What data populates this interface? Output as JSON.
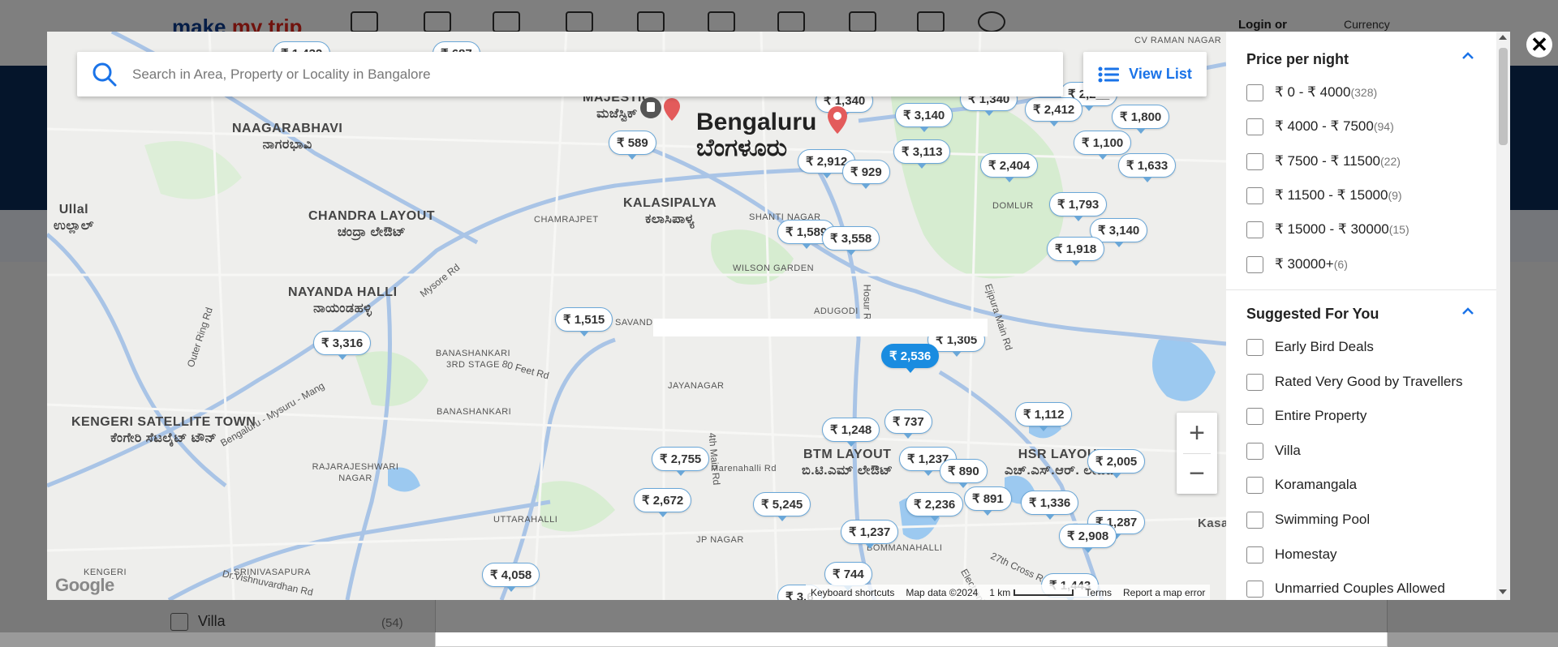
{
  "background": {
    "logo_main": "make",
    "logo_accent": "my trip",
    "login_label": "Login or",
    "currency_label": "Currency",
    "filter_item": {
      "label": "Villa",
      "count": "(54)"
    }
  },
  "map": {
    "search": {
      "placeholder": "Search in Area, Property or Locality in Bangalore",
      "value": ""
    },
    "view_list_label": "View List",
    "city": {
      "name": "Bengaluru",
      "name_local": "ಬೆಂಗಳೂರು"
    },
    "areas": [
      {
        "en": "NAAGARABHAVI",
        "local": "ನಾಗರಭಾವಿ"
      },
      {
        "en": "CHANDRA LAYOUT",
        "local": "ಚಂದ್ರಾ ಲೇಔಟ್"
      },
      {
        "en": "NAYANDA HALLI",
        "local": "ನಾಯಂಡಹಳ್ಳಿ"
      },
      {
        "en": "KALASIPALYA",
        "local": "ಕಲಾಸಿಪಾಳ್ಯ"
      },
      {
        "en": "KENGERI SATELLITE TOWN",
        "local": "ಕೆಂಗೇರಿ ಸೆಟಲೈಟ್ ಟೌನ್"
      },
      {
        "en": "BTM LAYOUT",
        "local": "ಬಿ.ಟಿ.ಎಮ್ ಲೇಔಟ್"
      },
      {
        "en": "HSR LAYOUT",
        "local": "ಎಚ್.ಎಸ್.ಆರ್. ಲೇಔಟ್"
      },
      {
        "en": "Ullal",
        "local": "ಉಲ್ಲಾಲ್"
      },
      {
        "en": "MAJESTIC",
        "local": "ಮಜೆಸ್ಟಿಕ್"
      }
    ],
    "small_labels": [
      "CHAMRAJPET",
      "SHANTI NAGAR",
      "WILSON GARDEN",
      "ADUGODI",
      "JAYANAGAR",
      "BANASHANKARI 3RD STAGE",
      "BANASHANKARI",
      "RAJARAJESHWARI NAGAR",
      "UTTARAHALLI",
      "JP NAGAR",
      "BOMMANAHALLI",
      "SAVANDURGA",
      "Marenahalli Rd",
      "DOMLUR",
      "CV RAMAN NAGAR",
      "KENGERI",
      "SRINIVASAPURA",
      "Kasa"
    ],
    "road_labels": [
      "Mysore Rd",
      "80 Feet Rd",
      "Outer Ring Rd",
      "Bengaluru - Mysuru - Mang",
      "Hosur Rd",
      "Ejipura Main Rd",
      "4th Main Rd",
      "27th Cross Rd",
      "Dr.Vishnuvardhan Rd",
      "Electronic City"
    ],
    "price_pins": [
      "₹ 1,432",
      "₹ 687",
      "₹ 1,340",
      "₹ 1,340",
      "₹ 2,2__",
      "₹ 3,140",
      "₹ 2,412",
      "₹ 1,800",
      "₹ 589",
      "₹ 2,912",
      "₹ 3,113",
      "₹ 929",
      "₹ 1,100",
      "₹ 2,404",
      "₹ 1,633",
      "₹ 1,793",
      "₹ 1,589",
      "₹ 3,558",
      "₹ 3,140",
      "₹ 1,918",
      "₹ 1,515",
      "₹ 3,316",
      "₹ 1,305",
      "₹ 2,536",
      "₹ 1,112",
      "₹ 1,248",
      "₹ 737",
      "₹ 2,755",
      "₹ 1,237",
      "₹ 890",
      "₹ 2,005",
      "₹ 891",
      "₹ 1,336",
      "₹ 2,672",
      "₹ 5,245",
      "₹ 2,236",
      "₹ 1,287",
      "₹ 1,237",
      "₹ 2,908",
      "₹ 4,058",
      "₹ 744",
      "₹ 1,443",
      "₹ 3,6"
    ],
    "active_pin": "₹ 2,536",
    "zoom_in": "+",
    "zoom_out": "−",
    "google_label": "Google",
    "attribution": {
      "shortcuts": "Keyboard shortcuts",
      "data": "Map data ©2024",
      "scale": "1 km",
      "terms": "Terms",
      "report": "Report a map error"
    }
  },
  "sidebar": {
    "price_title": "Price per night",
    "price_options": [
      {
        "label": "₹ 0 - ₹ 4000",
        "count": "(328)"
      },
      {
        "label": "₹ 4000 - ₹ 7500",
        "count": "(94)"
      },
      {
        "label": "₹ 7500 - ₹ 11500",
        "count": "(22)"
      },
      {
        "label": "₹ 11500 - ₹ 15000",
        "count": "(9)"
      },
      {
        "label": "₹ 15000 - ₹ 30000",
        "count": "(15)"
      },
      {
        "label": "₹ 30000+",
        "count": "(6)"
      }
    ],
    "suggested_title": "Suggested For You",
    "suggested_options": [
      "Early Bird Deals",
      "Rated Very Good by Travellers",
      "Entire Property",
      "Villa",
      "Koramangala",
      "Swimming Pool",
      "Homestay",
      "Unmarried Couples Allowed"
    ]
  },
  "close_label": "✕"
}
